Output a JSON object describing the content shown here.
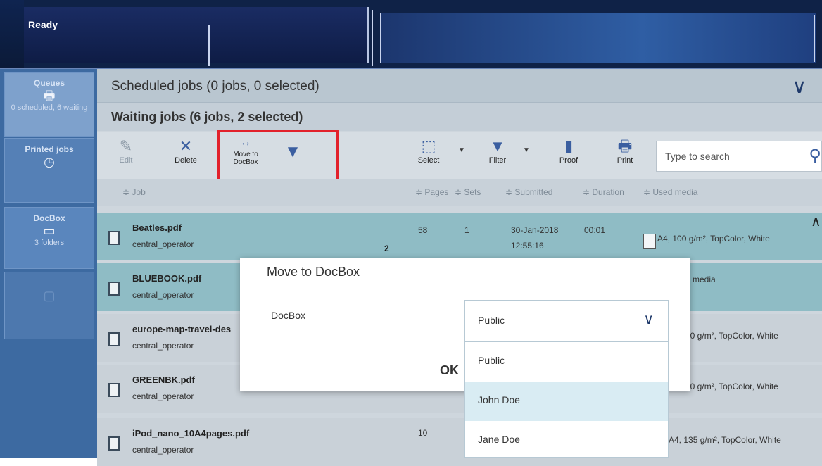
{
  "status": {
    "text": "Ready"
  },
  "sidebar": {
    "queues": {
      "title": "Queues",
      "sub": "0 scheduled, 6 waiting"
    },
    "printed": {
      "title": "Printed jobs"
    },
    "docbox": {
      "title": "DocBox",
      "sub": "3 folders"
    }
  },
  "scheduled": {
    "title": "Scheduled jobs (0 jobs, 0 selected)"
  },
  "waiting": {
    "title": "Waiting jobs (6 jobs, 2 selected)"
  },
  "toolbar": {
    "edit": "Edit",
    "delete": "Delete",
    "move_to_docbox": "Move to DocBox",
    "select": "Select",
    "filter": "Filter",
    "proof": "Proof",
    "print": "Print",
    "search_placeholder": "Type to search"
  },
  "columns": {
    "job": "≑ Job",
    "pages": "≑ Pages",
    "sets": "≑ Sets",
    "submitted": "≑ Submitted",
    "duration": "≑ Duration",
    "used_media": "≑ Used media"
  },
  "jobs": [
    {
      "name": "Beatles.pdf",
      "operator": "central_operator",
      "pages": "58",
      "sets": "1",
      "submitted_date": "30-Jan-2018",
      "submitted_time": "12:55:16",
      "duration": "00:01",
      "media": "A4, 100 g/m², TopColor, White",
      "extra": "2"
    },
    {
      "name": "BLUEBOOK.pdf",
      "operator": "central_operator",
      "media": "d media"
    },
    {
      "name": "europe-map-travel-des",
      "operator": "central_operator",
      "media": "00 g/m², TopColor, White"
    },
    {
      "name": "GREENBK.pdf",
      "operator": "central_operator",
      "media": "00 g/m², TopColor, White"
    },
    {
      "name": "iPod_nano_10A4pages.pdf",
      "operator": "central_operator",
      "pages": "10",
      "media": "A4, 135 g/m², TopColor, White"
    }
  ],
  "dialog": {
    "title": "Move to DocBox",
    "label": "DocBox",
    "selected": "Public",
    "ok": "OK",
    "options": [
      "Public",
      "John Doe",
      "Jane Doe"
    ]
  }
}
